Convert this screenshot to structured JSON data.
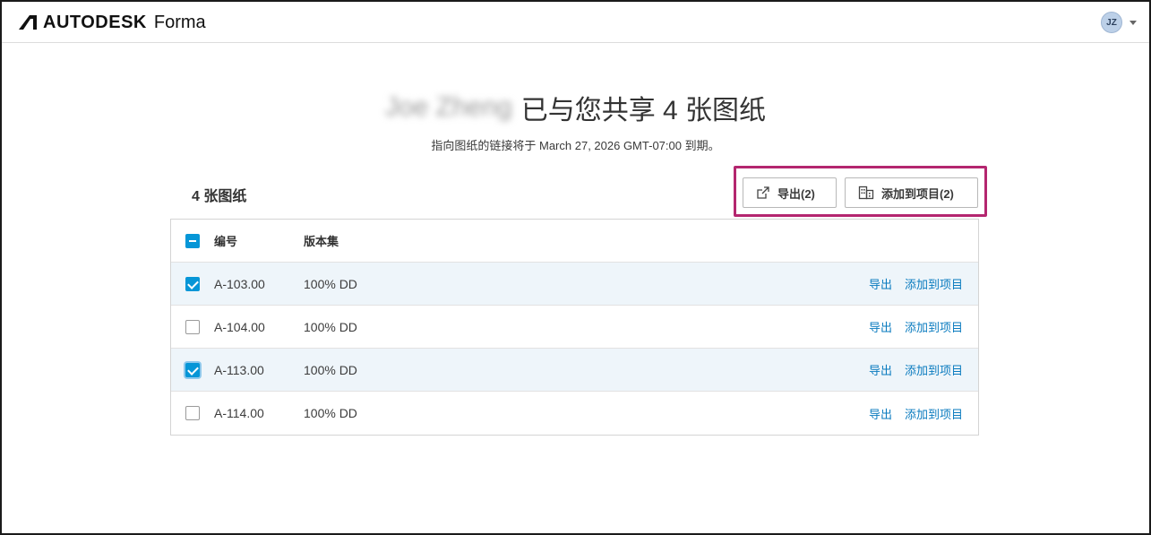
{
  "header": {
    "brand": "AUTODESK",
    "product": "Forma",
    "user_initials": "JZ"
  },
  "title": {
    "sharer_name": "Joe Zheng",
    "shared_text": "已与您共享 4 张图纸",
    "expiry_notice": "指向图纸的链接将于 March 27, 2026 GMT-07:00 到期。"
  },
  "toolbar": {
    "sheet_count": "4 张图纸",
    "export_label": "导出(2)",
    "add_label": "添加到项目(2)"
  },
  "table": {
    "columns": {
      "number": "编号",
      "set": "版本集"
    },
    "rows": [
      {
        "number": "A-103.00",
        "set": "100% DD",
        "selected": true,
        "export": "导出",
        "add": "添加到项目"
      },
      {
        "number": "A-104.00",
        "set": "100% DD",
        "selected": false,
        "export": "导出",
        "add": "添加到项目"
      },
      {
        "number": "A-113.00",
        "set": "100% DD",
        "selected": true,
        "export": "导出",
        "add": "添加到项目"
      },
      {
        "number": "A-114.00",
        "set": "100% DD",
        "selected": false,
        "export": "导出",
        "add": "添加到项目"
      }
    ]
  },
  "colors": {
    "accent": "#0696d7",
    "link": "#0a7bbf",
    "highlight_border": "#b4266f",
    "selected_row": "#eef5fa"
  },
  "icons": [
    "autodesk-logo-icon",
    "caret-down-icon",
    "share-export-icon",
    "building-icon",
    "checkbox-icon"
  ]
}
